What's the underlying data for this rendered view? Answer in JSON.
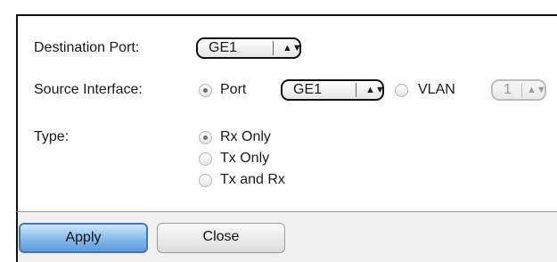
{
  "form": {
    "destination_port": {
      "label": "Destination Port:",
      "value": "GE1"
    },
    "source_interface": {
      "label": "Source Interface:",
      "port_label": "Port",
      "port_value": "GE1",
      "vlan_label": "VLAN",
      "vlan_value": "1",
      "selected": "Port"
    },
    "type": {
      "label": "Type:",
      "options": [
        "Rx Only",
        "Tx Only",
        "Tx and Rx"
      ],
      "selected": "Rx Only"
    }
  },
  "buttons": {
    "apply": "Apply",
    "close": "Close"
  },
  "icons": {
    "select_arrows": "updown-arrows-icon"
  }
}
